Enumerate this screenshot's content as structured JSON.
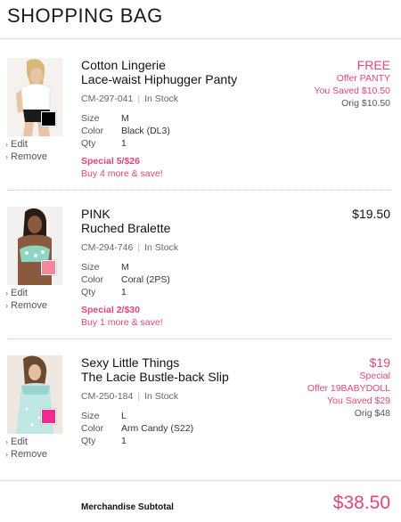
{
  "header": {
    "title": "SHOPPING BAG"
  },
  "labels": {
    "size": "Size",
    "color": "Color",
    "qty": "Qty",
    "edit": "Edit",
    "remove": "Remove"
  },
  "items": [
    {
      "name_line1": "Cotton Lingerie",
      "name_line2": "Lace-waist Hiphugger Panty",
      "sku": "CM-297-041",
      "stock": "In Stock",
      "size": "M",
      "color": "Black (DL3)",
      "qty": "1",
      "promo_title": "Special 5/$26",
      "promo_note": "Buy 4 more & save!",
      "price_main": "FREE",
      "price_lines": [
        "Offer PANTY",
        "You Saved $10.50"
      ],
      "price_orig": "Orig $10.50",
      "swatch_color": "#000000"
    },
    {
      "name_line1": "PINK",
      "name_line2": "Ruched Bralette",
      "sku": "CM-294-746",
      "stock": "In Stock",
      "size": "M",
      "color": "Coral (2PS)",
      "qty": "1",
      "promo_title": "Special 2/$30",
      "promo_note": "Buy 1 more & save!",
      "price_main": "$19.50",
      "swatch_color": "#f4879f"
    },
    {
      "name_line1": "Sexy Little Things",
      "name_line2": "The Lacie Bustle-back Slip",
      "sku": "CM-250-184",
      "stock": "In Stock",
      "size": "L",
      "color": "Arm Candy (S22)",
      "qty": "1",
      "price_main": "$19",
      "price_lines": [
        "Special",
        "Offer 19BABYDOLL",
        "You Saved $29"
      ],
      "price_orig": "Orig $48",
      "swatch_color": "#ee2b8f"
    }
  ],
  "summary": {
    "subtotal_label": "Merchandise Subtotal",
    "subtotal_value": "$38.50"
  },
  "colors": {
    "accent": "#e0457b",
    "text": "#222222",
    "divider": "#dcdcdc"
  }
}
